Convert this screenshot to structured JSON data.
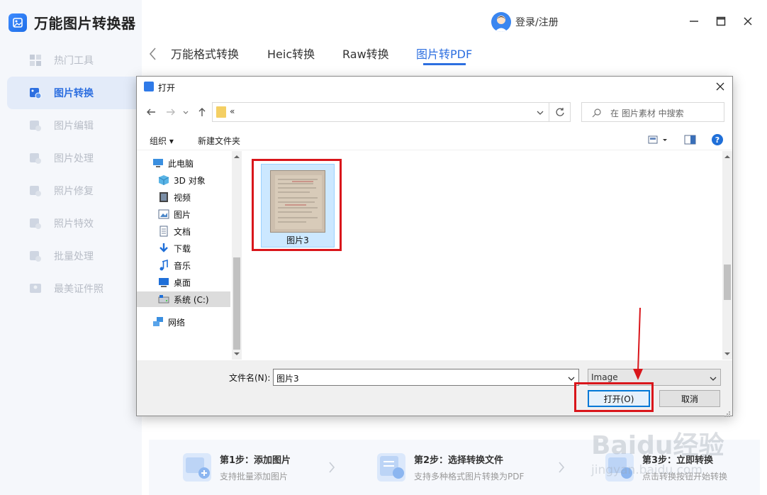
{
  "app": {
    "title": "万能图片转换器",
    "user_label": "登录/注册"
  },
  "sidebar": {
    "items": [
      {
        "label": "热门工具",
        "icon": "grid-icon"
      },
      {
        "label": "图片转换",
        "icon": "image-convert-icon",
        "active": true
      },
      {
        "label": "图片编辑",
        "icon": "image-edit-icon"
      },
      {
        "label": "图片处理",
        "icon": "image-process-icon"
      },
      {
        "label": "照片修复",
        "icon": "photo-repair-icon"
      },
      {
        "label": "照片特效",
        "icon": "photo-effect-icon"
      },
      {
        "label": "批量处理",
        "icon": "batch-icon"
      },
      {
        "label": "最美证件照",
        "icon": "id-photo-icon"
      }
    ]
  },
  "tabs": [
    {
      "label": "万能格式转换"
    },
    {
      "label": "Heic转换"
    },
    {
      "label": "Raw转换"
    },
    {
      "label": "图片转PDF",
      "active": true
    }
  ],
  "steps": [
    {
      "title": "第1步：添加图片",
      "subtitle": "支持批量添加图片"
    },
    {
      "title": "第2步：选择转换文件",
      "subtitle": "支持多种格式图片转换为PDF"
    },
    {
      "title": "第3步：立即转换",
      "subtitle": "点击转换按钮开始转换"
    }
  ],
  "dialog": {
    "title": "打开",
    "address_text": "«",
    "search_placeholder": "在 图片素材 中搜索",
    "organize_label": "组织 ▾",
    "new_folder_label": "新建文件夹",
    "help_symbol": "?",
    "nav_tree": [
      {
        "label": "此电脑",
        "icon": "computer-icon",
        "indent": 0
      },
      {
        "label": "3D 对象",
        "icon": "cube-3d-icon",
        "indent": 1
      },
      {
        "label": "视频",
        "icon": "video-icon",
        "indent": 1
      },
      {
        "label": "图片",
        "icon": "picture-icon",
        "indent": 1
      },
      {
        "label": "文档",
        "icon": "document-icon",
        "indent": 1
      },
      {
        "label": "下载",
        "icon": "download-icon",
        "indent": 1
      },
      {
        "label": "音乐",
        "icon": "music-icon",
        "indent": 1
      },
      {
        "label": "桌面",
        "icon": "desktop-icon",
        "indent": 1
      },
      {
        "label": "系统 (C:)",
        "icon": "drive-icon",
        "indent": 1,
        "selected": true
      },
      {
        "label": "网络",
        "icon": "network-icon",
        "indent": 0
      }
    ],
    "files": [
      {
        "name": "图片3",
        "selected": true
      }
    ],
    "filename_label": "文件名(N):",
    "filename_value": "图片3",
    "filetype_value": "Image",
    "open_button": "打开(O)",
    "cancel_button": "取消"
  },
  "watermark": {
    "text": "Baidu经验",
    "sub": "jingyan.baidu.com"
  },
  "colors": {
    "accent": "#2d6fe0",
    "annotation": "#d9161b",
    "selection": "#cce8ff"
  }
}
